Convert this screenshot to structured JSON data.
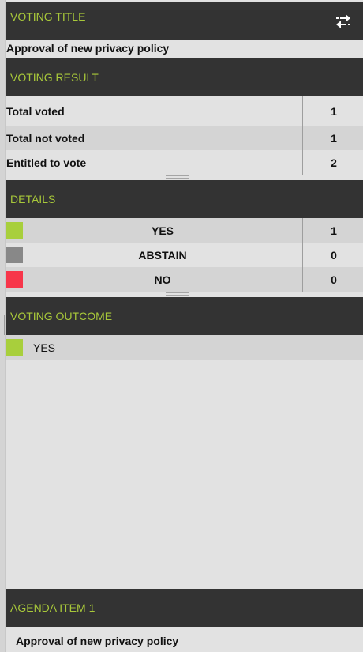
{
  "voting_title": {
    "header": "VOTING TITLE",
    "swap_icon": "swap-arrows-icon",
    "text": "Approval of new privacy policy"
  },
  "voting_result": {
    "header": "VOTING RESULT",
    "rows": [
      {
        "label": "Total voted",
        "value": "1"
      },
      {
        "label": "Total not voted",
        "value": "1"
      },
      {
        "label": "Entitled to vote",
        "value": "2"
      }
    ]
  },
  "details": {
    "header": "DETAILS",
    "rows": [
      {
        "label": "YES",
        "value": "1",
        "color": "#a8cf3c"
      },
      {
        "label": "ABSTAIN",
        "value": "0",
        "color": "#888888"
      },
      {
        "label": "NO",
        "value": "0",
        "color": "#f7364a"
      }
    ]
  },
  "voting_outcome": {
    "header": "VOTING OUTCOME",
    "label": "YES",
    "color": "#a8cf3c"
  },
  "agenda_item": {
    "header": "AGENDA ITEM 1",
    "text": "Approval of new privacy policy"
  },
  "colors": {
    "header_bg": "#333333",
    "header_text": "#a8c83a",
    "panel_bg": "#e2e2e2",
    "row_alt_bg": "#d4d4d4"
  }
}
